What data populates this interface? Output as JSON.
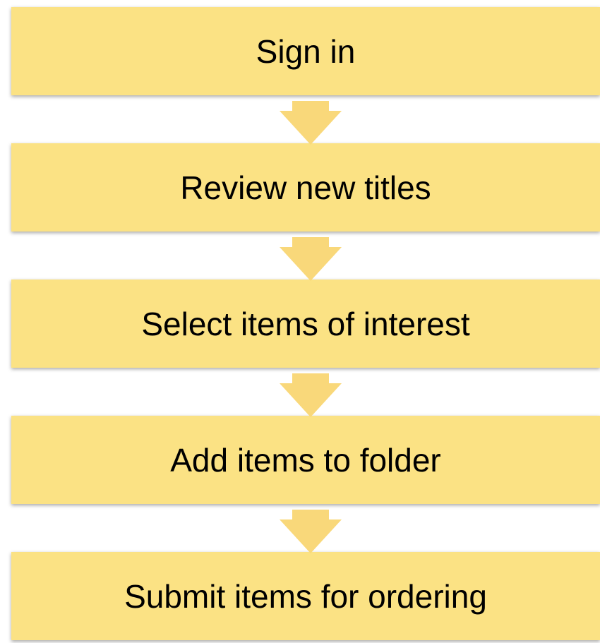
{
  "colors": {
    "box_fill": "#fbe284",
    "arrow_fill": "#f9d87a",
    "text": "#000000"
  },
  "steps": [
    {
      "label": "Sign in"
    },
    {
      "label": "Review new titles"
    },
    {
      "label": "Select items of interest"
    },
    {
      "label": "Add items to folder"
    },
    {
      "label": "Submit items for ordering"
    }
  ]
}
